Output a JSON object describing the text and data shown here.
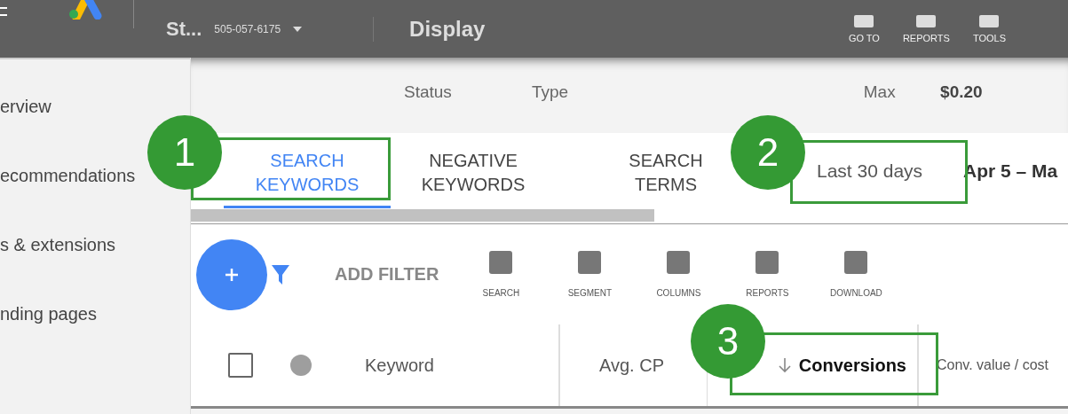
{
  "top_bar": {
    "account_name": "St...",
    "account_id": "505-057-6175",
    "campaign": "Display",
    "tools": [
      {
        "label": "GO TO"
      },
      {
        "label": "REPORTS"
      },
      {
        "label": "TOOLS"
      }
    ]
  },
  "sidebar": {
    "items": [
      {
        "label": "erview",
        "selected": false
      },
      {
        "label": "ecommendations",
        "selected": false
      },
      {
        "label": "s & extensions",
        "selected": false
      },
      {
        "label": "nding pages",
        "selected": false
      }
    ]
  },
  "summary": {
    "headers": [
      "Status",
      "Type",
      "Max",
      "$0.20"
    ]
  },
  "tabs": [
    {
      "label": "SEARCH KEYWORDS",
      "selected": true
    },
    {
      "label": "NEGATIVE KEYWORDS",
      "selected": false
    },
    {
      "label": "SEARCH TERMS",
      "selected": false
    }
  ],
  "date": {
    "preset": "Last 30 days",
    "range": "Apr 5 – Ma"
  },
  "toolbar": {
    "filter": "ADD FILTER",
    "tools": [
      {
        "label": "SEARCH"
      },
      {
        "label": "SEGMENT"
      },
      {
        "label": "COLUMNS"
      },
      {
        "label": "REPORTS"
      },
      {
        "label": "DOWNLOAD"
      }
    ]
  },
  "table": {
    "select_all": {
      "checked": false
    },
    "columns": [
      {
        "label": "Keyword",
        "sorted": false
      },
      {
        "label": "Avg. CP",
        "sorted": false
      },
      {
        "label": "Conversions",
        "sorted": true
      },
      {
        "label": "Conv. value / cost",
        "sorted": false
      }
    ]
  },
  "annotations": [
    {
      "number": "1"
    },
    {
      "number": "2"
    },
    {
      "number": "3"
    }
  ]
}
